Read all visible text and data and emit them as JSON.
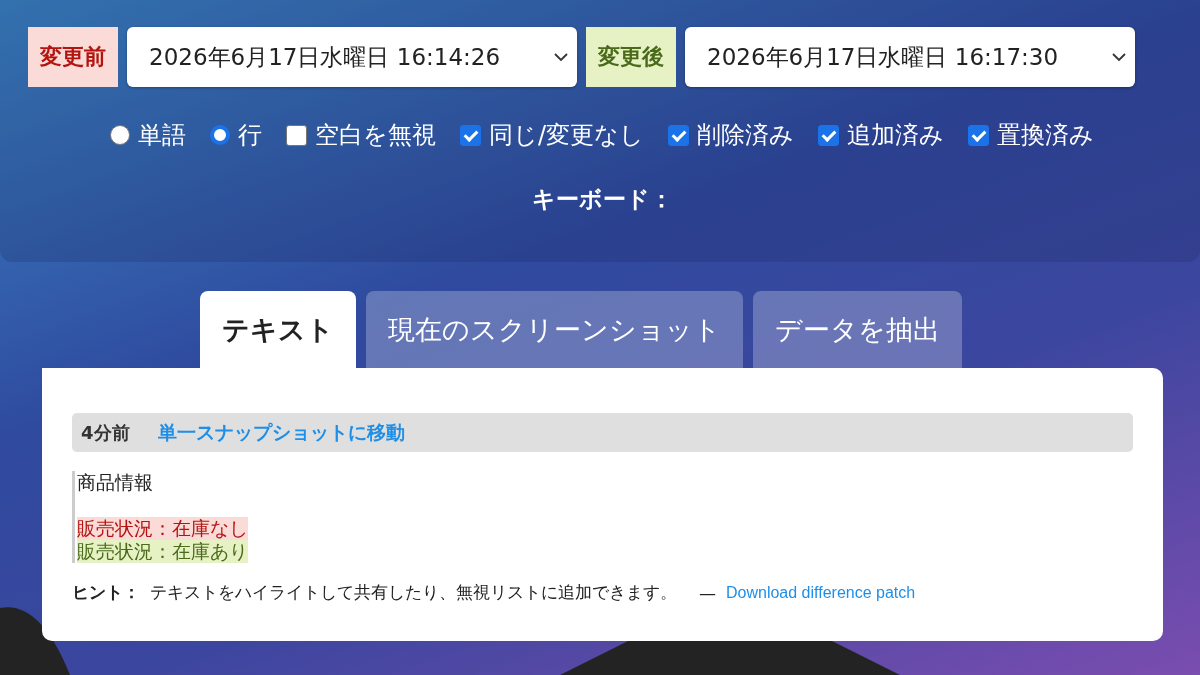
{
  "comparison": {
    "before": {
      "label": "変更前",
      "value": "2026年6月17日水曜日 16:14:26"
    },
    "after": {
      "label": "変更後",
      "value": "2026年6月17日水曜日 16:17:30"
    }
  },
  "options": [
    {
      "kind": "radio",
      "label": "単語",
      "selected": false
    },
    {
      "kind": "radio",
      "label": "行",
      "selected": true
    },
    {
      "kind": "checkbox",
      "label": "空白を無視",
      "checked": false
    },
    {
      "kind": "checkbox",
      "label": "同じ/変更なし",
      "checked": true
    },
    {
      "kind": "checkbox",
      "label": "削除済み",
      "checked": true
    },
    {
      "kind": "checkbox",
      "label": "追加済み",
      "checked": true
    },
    {
      "kind": "checkbox",
      "label": "置換済み",
      "checked": true
    }
  ],
  "keyboard_label": "キーボード：",
  "tabs": [
    {
      "label": "テキスト",
      "selected": true
    },
    {
      "label": "現在のスクリーンショット",
      "selected": false
    },
    {
      "label": "データを抽出",
      "selected": false
    }
  ],
  "snapshot_bar": {
    "age": "4分前",
    "link": "単一スナップショットに移動"
  },
  "diff_lines": [
    {
      "kind": "unchanged",
      "text": "商品情報"
    },
    {
      "kind": "removed",
      "text": "販売状況：在庫なし"
    },
    {
      "kind": "added",
      "text": "販売状況：在庫あり"
    }
  ],
  "hint": {
    "label": "ヒント：",
    "text": "テキストをハイライトして共有したり、無視リストに追加できます。",
    "separator": "—",
    "link": "Download difference patch"
  }
}
